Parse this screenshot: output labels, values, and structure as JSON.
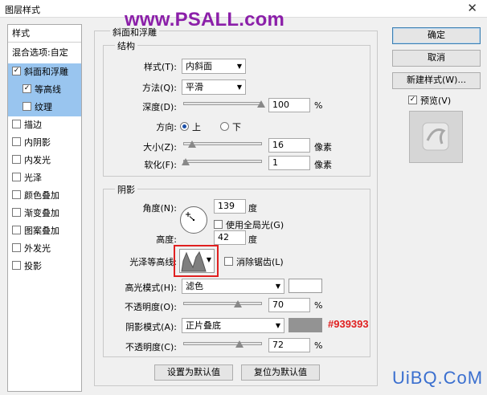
{
  "window": {
    "title": "图层样式"
  },
  "watermark": "www.PSALL.com",
  "sidebar": {
    "header": "样式",
    "items": [
      {
        "label": "混合选项:自定"
      },
      {
        "label": "斜面和浮雕",
        "checked": true,
        "selected": true
      },
      {
        "label": "等高线",
        "checked": true,
        "selected": true
      },
      {
        "label": "纹理",
        "checked": false,
        "selected": true
      },
      {
        "label": "描边",
        "checked": false
      },
      {
        "label": "内阴影",
        "checked": false
      },
      {
        "label": "内发光",
        "checked": false
      },
      {
        "label": "光泽",
        "checked": false
      },
      {
        "label": "颜色叠加",
        "checked": false
      },
      {
        "label": "渐变叠加",
        "checked": false
      },
      {
        "label": "图案叠加",
        "checked": false
      },
      {
        "label": "外发光",
        "checked": false
      },
      {
        "label": "投影",
        "checked": false
      }
    ]
  },
  "bevel": {
    "group_title": "斜面和浮雕",
    "structure_title": "结构",
    "style": {
      "label": "样式(T):",
      "value": "内斜面"
    },
    "technique": {
      "label": "方法(Q):",
      "value": "平滑"
    },
    "depth": {
      "label": "深度(D):",
      "value": "100",
      "unit": "%",
      "level": 1.0
    },
    "direction": {
      "label": "方向:",
      "up": "上",
      "down": "下",
      "selected": "up"
    },
    "size": {
      "label": "大小(Z):",
      "value": "16",
      "unit": "像素",
      "level": 0.1
    },
    "soften": {
      "label": "软化(F):",
      "value": "1",
      "unit": "像素",
      "level": 0.02
    },
    "shading_title": "阴影",
    "angle": {
      "label": "角度(N):",
      "value": "139",
      "unit": "度"
    },
    "global_light": {
      "label": "使用全局光(G)",
      "checked": false
    },
    "altitude": {
      "label": "高度:",
      "value": "42",
      "unit": "度"
    },
    "gloss": {
      "label": "光泽等高线:"
    },
    "anti_alias": {
      "label": "消除锯齿(L)",
      "checked": false
    },
    "highlight": {
      "label": "高光模式(H):",
      "value": "滤色",
      "color": "#ffffff"
    },
    "highlight_opacity": {
      "label": "不透明度(O):",
      "value": "70",
      "unit": "%",
      "level": 0.7
    },
    "shadow": {
      "label": "阴影模式(A):",
      "value": "正片叠底",
      "color": "#939393",
      "annotation": "#939393"
    },
    "shadow_opacity": {
      "label": "不透明度(C):",
      "value": "72",
      "unit": "%",
      "level": 0.72
    },
    "make_default": "设置为默认值",
    "reset_default": "复位为默认值"
  },
  "actions": {
    "ok": "确定",
    "cancel": "取消",
    "new_style": "新建样式(W)...",
    "preview": {
      "label": "预览(V)",
      "checked": true
    }
  },
  "footer_watermark": "UiBQ.CoM"
}
